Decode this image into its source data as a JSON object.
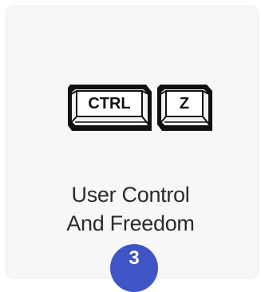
{
  "card": {
    "icons": {
      "left_key": "ctrl-key-icon",
      "right_key": "z-key-icon"
    },
    "keys": {
      "ctrl_label": "CTRL",
      "z_label": "Z"
    },
    "title": {
      "line1": "User Control",
      "line2": "And Freedom"
    },
    "badge": "3",
    "colors": {
      "badge_bg": "#3f55c6",
      "card_bg": "#f7f7f7",
      "text": "#2b2b2b"
    }
  }
}
